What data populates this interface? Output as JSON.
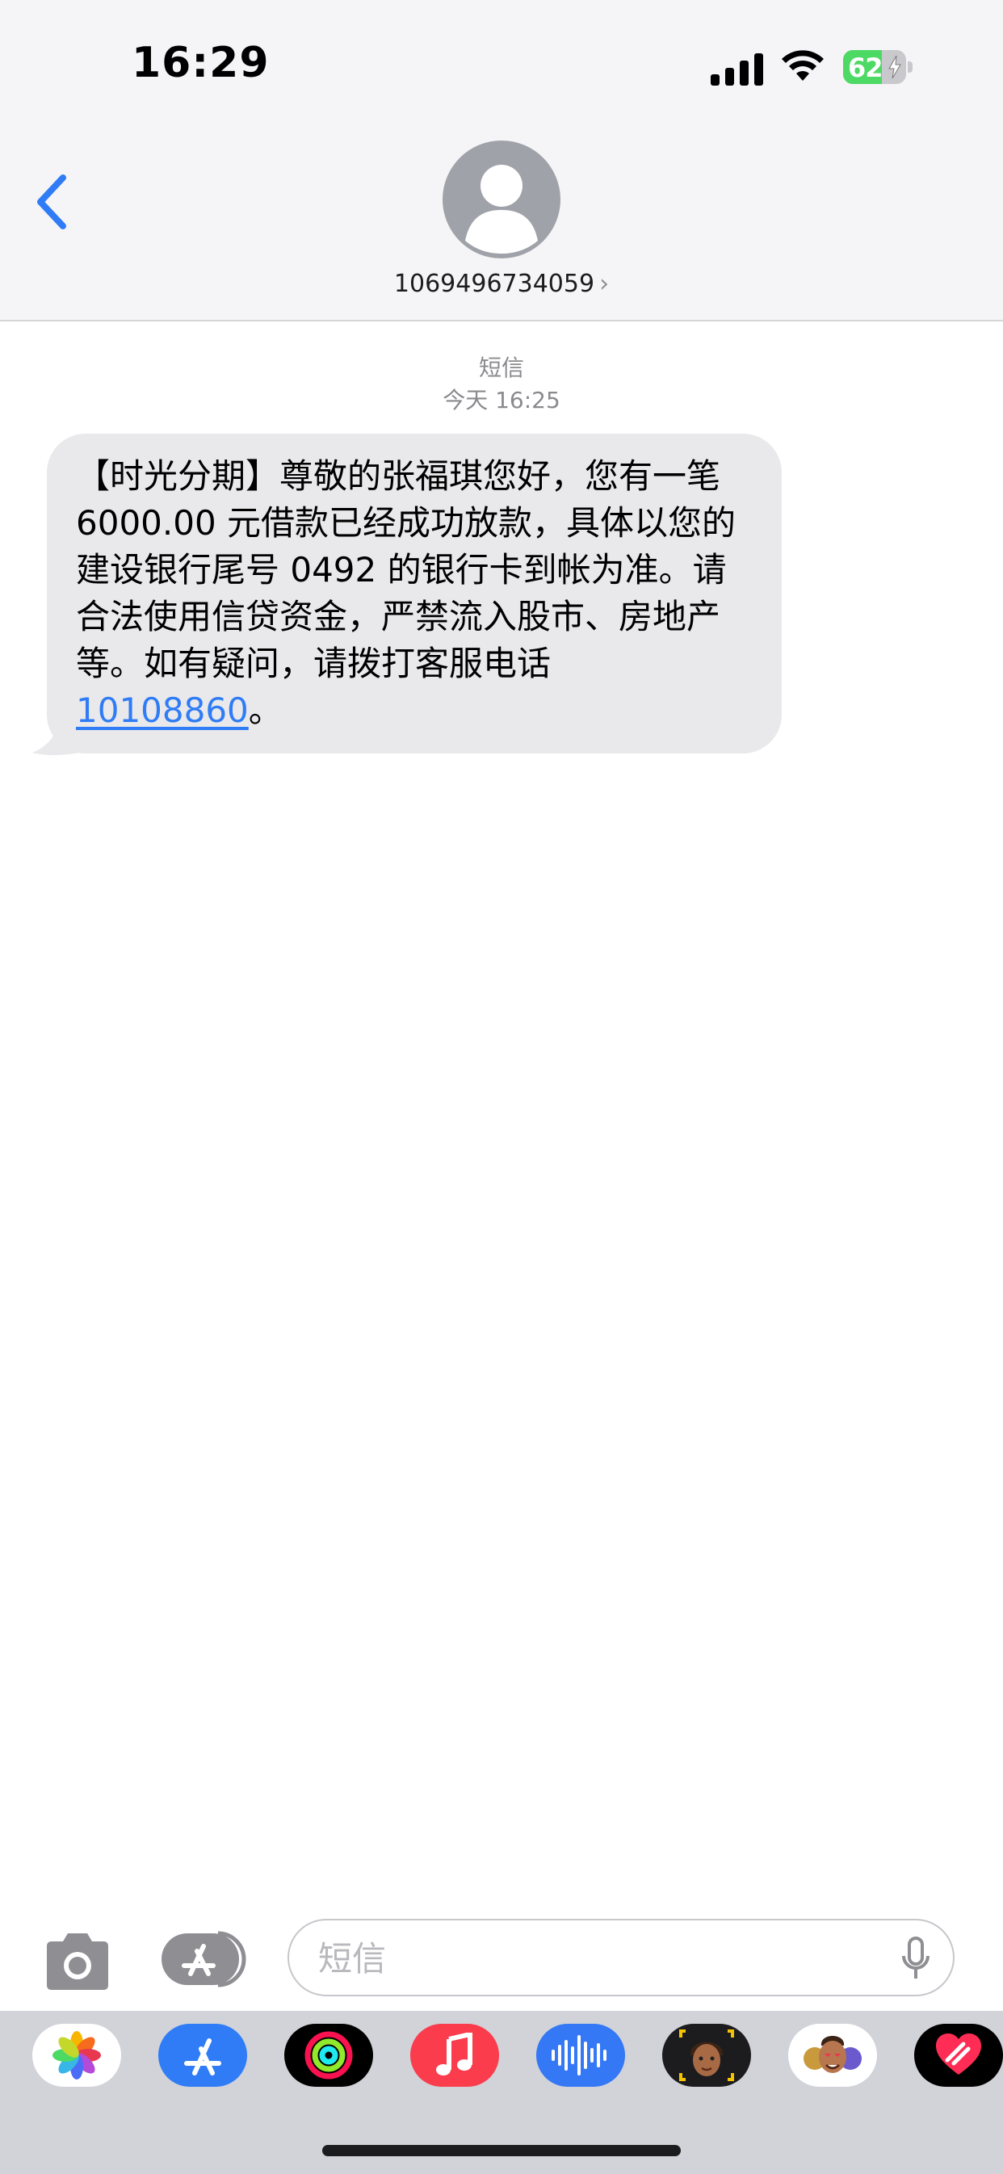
{
  "status_bar": {
    "time": "16:29",
    "battery_percent": "62",
    "battery_level": 0.62,
    "charging": true
  },
  "header": {
    "contact": "1069496734059",
    "contact_chevron": "›"
  },
  "conversation": {
    "service_label": "短信",
    "timestamp": "今天 16:25",
    "message": {
      "text_before_link": "【时光分期】尊敬的张福琪您好，您有一笔 6000.00 元借款已经成功放款，具体以您的建设银行尾号 0492 的银行卡到帐为准。请合法使用信贷资金，严禁流入股市、房地产等。如有疑问，请拨打客服电话 ",
      "link": "10108860",
      "text_after_link": "。"
    }
  },
  "input_bar": {
    "placeholder": "短信"
  },
  "app_drawer": {
    "apps": [
      {
        "name": "photos-icon"
      },
      {
        "name": "app-store-icon"
      },
      {
        "name": "activity-icon"
      },
      {
        "name": "music-icon"
      },
      {
        "name": "audio-message-icon"
      },
      {
        "name": "memoji-icon"
      },
      {
        "name": "memoji-stickers-icon"
      },
      {
        "name": "digital-touch-icon"
      }
    ]
  },
  "colors": {
    "accent": "#2f7cf6",
    "bubble": "#e9e9eb",
    "header_bg": "#f5f5f7",
    "battery_green": "#4cd964"
  }
}
